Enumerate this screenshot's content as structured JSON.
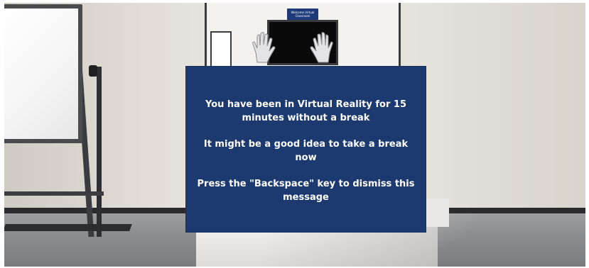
{
  "scene": {
    "sign_text": "Welcome Virtual Classroom"
  },
  "dialog": {
    "message_1": "You have been in Virtual Reality for 15 minutes without a break",
    "message_2": "It might be a good idea to take a break now",
    "message_3": "Press the \"Backspace\" key to dismiss this message"
  },
  "colors": {
    "dialog_background": "#1d3a70",
    "dialog_text": "#ffffff"
  },
  "icons": {
    "left_hand": "vr-left-hand-icon",
    "right_hand": "vr-right-hand-icon"
  }
}
